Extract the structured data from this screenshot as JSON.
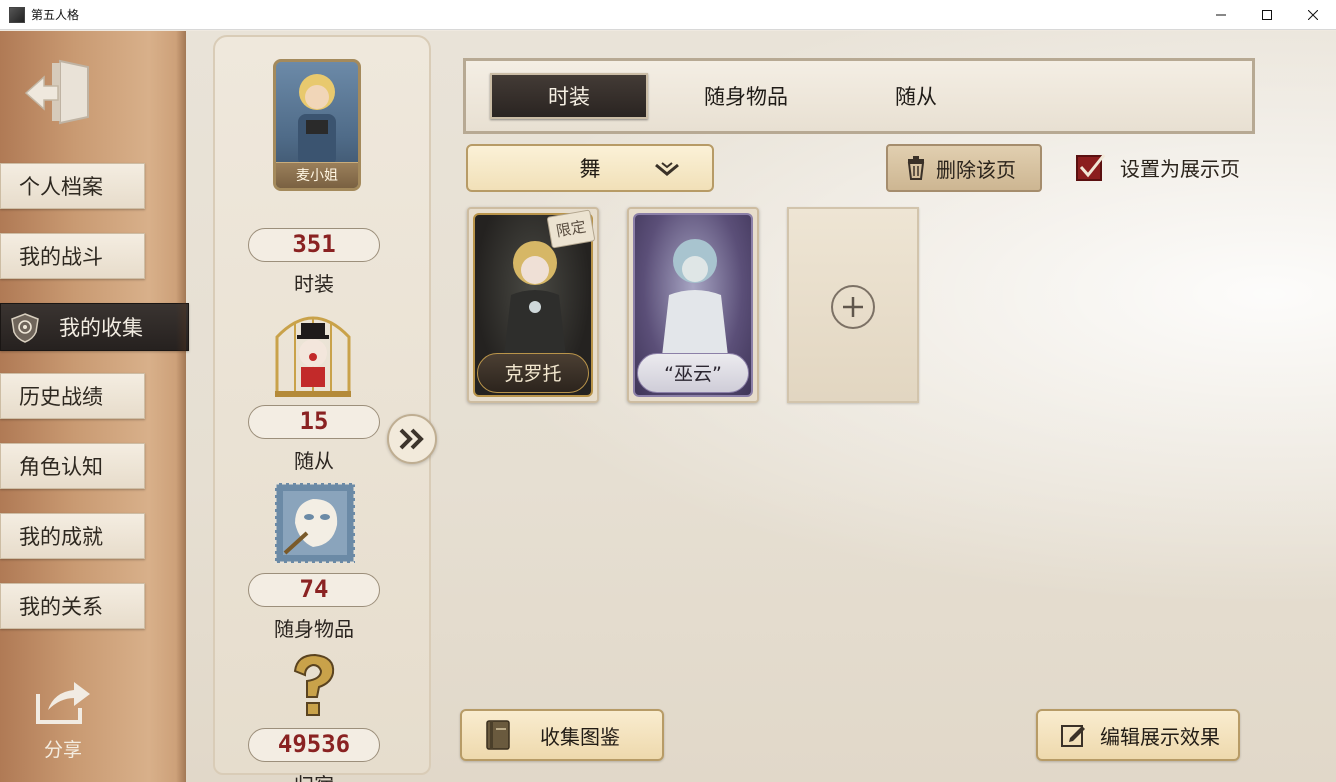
{
  "window": {
    "title": "第五人格"
  },
  "sidebar": {
    "items": [
      {
        "label": "个人档案"
      },
      {
        "label": "我的战斗"
      },
      {
        "label": "我的收集",
        "active": true
      },
      {
        "label": "历史战绩"
      },
      {
        "label": "角色认知"
      },
      {
        "label": "我的成就"
      },
      {
        "label": "我的关系"
      }
    ],
    "share_label": "分享"
  },
  "stats": {
    "avatar_name": "麦小姐",
    "costumes": {
      "count": "351",
      "label": "时装"
    },
    "followers": {
      "count": "15",
      "label": "随从"
    },
    "accessories": {
      "count": "74",
      "label": "随身物品"
    },
    "residence": {
      "count": "49536",
      "label": "归宿"
    }
  },
  "tabs": [
    {
      "label": "时装",
      "active": true
    },
    {
      "label": "随身物品"
    },
    {
      "label": "随从"
    }
  ],
  "filter": {
    "selected": "舞"
  },
  "actions": {
    "delete_page": "删除该页",
    "set_showcase": "设置为展示页"
  },
  "cards": [
    {
      "name": "克罗托",
      "badge": "限定"
    },
    {
      "name": "“巫云”"
    }
  ],
  "bottom": {
    "collection_book": "收集图鉴",
    "edit_showcase": "编辑展示效果"
  },
  "colors": {
    "leather": "#c99a72",
    "active_tab": "#2a2421",
    "count_red": "#8a2222",
    "gold_button": "#f1e0b8"
  }
}
